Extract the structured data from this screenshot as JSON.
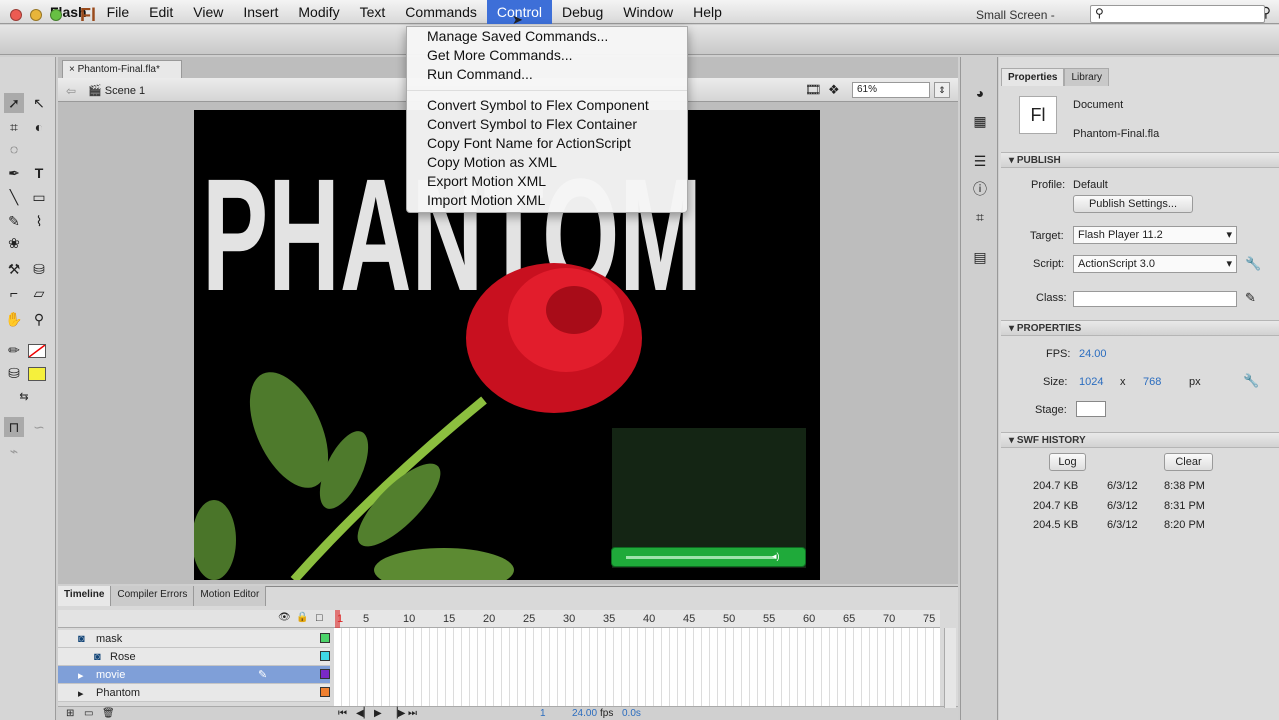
{
  "menubar": {
    "app": "Flash",
    "items": [
      "File",
      "Edit",
      "View",
      "Insert",
      "Modify",
      "Text",
      "Commands",
      "Control",
      "Debug",
      "Window",
      "Help"
    ],
    "active": "Control"
  },
  "appbar": {
    "logo": "Fl",
    "workspace": "Small Screen"
  },
  "document": {
    "tab": "Phantom-Final.fla*",
    "scene": "Scene 1",
    "zoom": "61%",
    "stage_title": "PHANTOM"
  },
  "commands_menu": {
    "group1": [
      "Manage Saved Commands...",
      "Get More Commands...",
      "Run Command..."
    ],
    "group2": [
      "Convert Symbol to Flex Component",
      "Convert Symbol to Flex Container",
      "Copy Font Name for ActionScript",
      "Copy Motion as XML",
      "Export Motion XML",
      "Import Motion XML"
    ]
  },
  "timeline": {
    "tabs": [
      "Timeline",
      "Compiler Errors",
      "Motion Editor"
    ],
    "layers": [
      "mask",
      "Rose",
      "movie",
      "Phantom"
    ],
    "ruler": [
      "1",
      "5",
      "10",
      "15",
      "20",
      "25",
      "30",
      "35",
      "40",
      "45",
      "50",
      "55",
      "60",
      "65",
      "70",
      "75"
    ],
    "frame": "1",
    "fps": "24.00",
    "fps_unit": "fps",
    "time": "0.0s"
  },
  "properties": {
    "tabs": [
      "Properties",
      "Library"
    ],
    "doc_type": "Document",
    "doc_name": "Phantom-Final.fla",
    "doc_icon": "Fl",
    "publish": {
      "header": "PUBLISH",
      "profile_label": "Profile:",
      "profile": "Default",
      "settings_button": "Publish Settings...",
      "target_label": "Target:",
      "target": "Flash Player 11.2",
      "script_label": "Script:",
      "script": "ActionScript 3.0",
      "class_label": "Class:"
    },
    "props": {
      "header": "PROPERTIES",
      "fps_label": "FPS:",
      "fps": "24.00",
      "size_label": "Size:",
      "width": "1024",
      "x": "x",
      "height": "768",
      "unit": "px",
      "stage_label": "Stage:"
    },
    "history": {
      "header": "SWF HISTORY",
      "log_button": "Log",
      "clear_button": "Clear",
      "rows": [
        {
          "size": "204.7 KB",
          "date": "6/3/12",
          "time": "8:38 PM"
        },
        {
          "size": "204.7 KB",
          "date": "6/3/12",
          "time": "8:31 PM"
        },
        {
          "size": "204.5 KB",
          "date": "6/3/12",
          "time": "8:20 PM"
        }
      ]
    }
  },
  "colors": {
    "menu_highlight": "#3d6fd8",
    "selected_layer": "#7f9fd8",
    "player_green": "#1faa3a",
    "value_blue": "#2b6dbf"
  }
}
